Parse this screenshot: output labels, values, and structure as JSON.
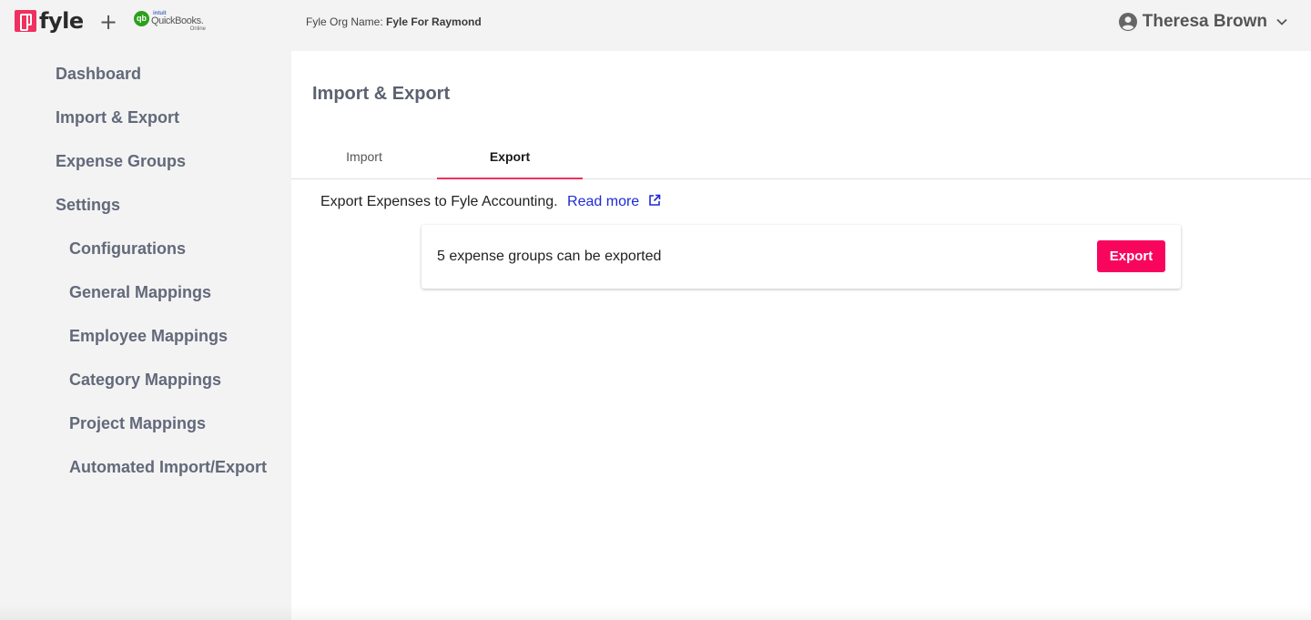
{
  "header": {
    "brand": "fyle",
    "plus": "+",
    "integration": {
      "badge": "qb",
      "intuit": "intuit",
      "name": "QuickBooks.",
      "edition": "Online"
    },
    "org_label": "Fyle Org Name:",
    "org_name": "Fyle For Raymond",
    "user_name": "Theresa Brown"
  },
  "sidebar": {
    "items": [
      {
        "label": "Dashboard"
      },
      {
        "label": "Import & Export"
      },
      {
        "label": "Expense Groups"
      },
      {
        "label": "Settings"
      }
    ],
    "settings_items": [
      {
        "label": "Configurations"
      },
      {
        "label": "General Mappings"
      },
      {
        "label": "Employee Mappings"
      },
      {
        "label": "Category Mappings"
      },
      {
        "label": "Project Mappings"
      },
      {
        "label": "Automated Import/Export"
      }
    ]
  },
  "main": {
    "title": "Import & Export",
    "tabs": [
      {
        "label": "Import",
        "active": false
      },
      {
        "label": "Export",
        "active": true
      }
    ],
    "description": "Export Expenses to Fyle Accounting.",
    "read_more": "Read more",
    "card": {
      "message": "5 expense groups can be exported",
      "button_label": "Export"
    }
  },
  "colors": {
    "accent": "#f8065e",
    "link": "#1f2ad6",
    "brand": "#f0305f",
    "quickbooks": "#2ca01c"
  }
}
